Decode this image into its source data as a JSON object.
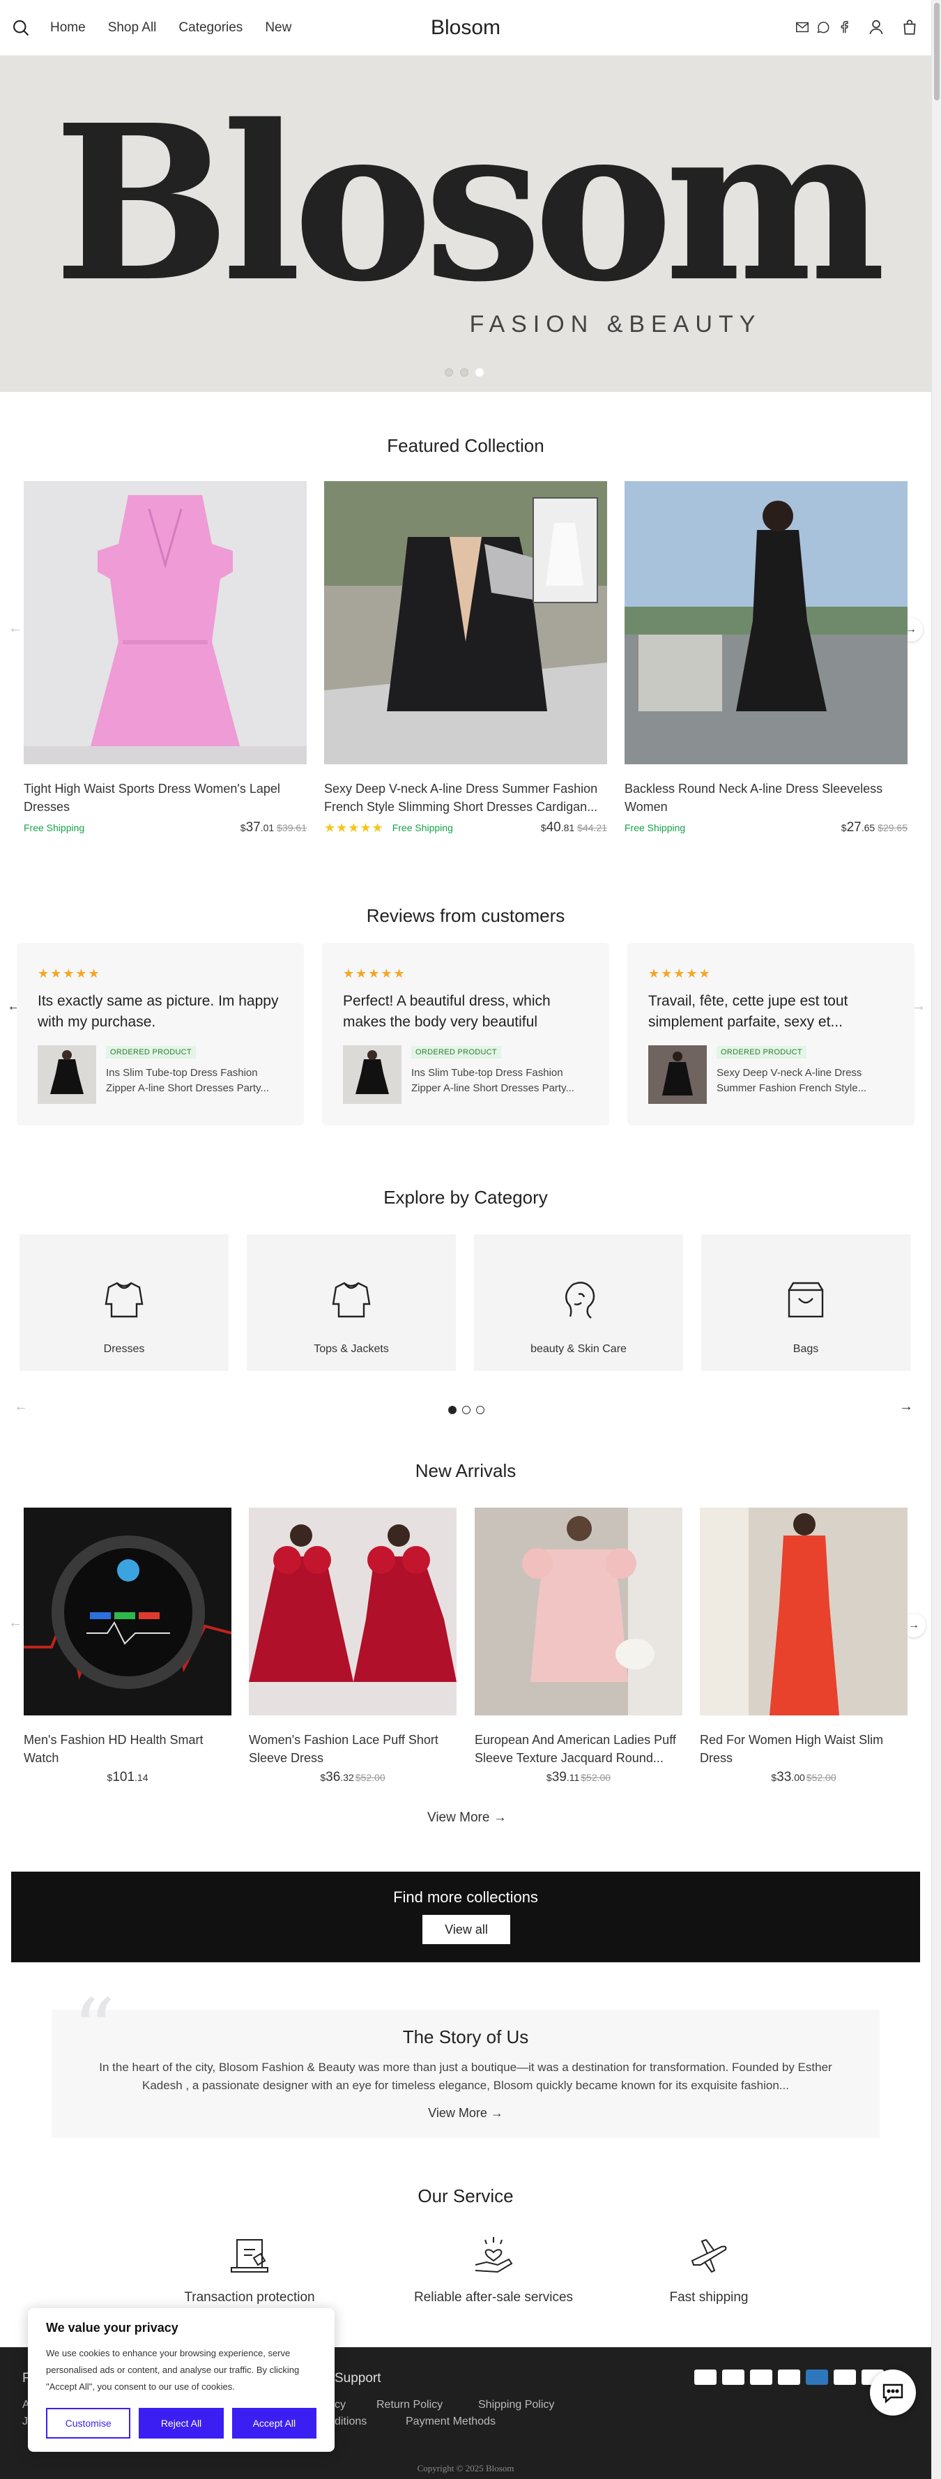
{
  "header": {
    "nav": [
      "Home",
      "Shop All",
      "Categories",
      "New"
    ],
    "brand": "Blosom"
  },
  "hero": {
    "logo_text": "Blosom",
    "subtitle": "FASION &BEAUTY",
    "slides": 3,
    "active_slide": 3
  },
  "featured": {
    "title": "Featured Collection",
    "products": [
      {
        "name": "Tight High Waist Sports Dress Women's Lapel Dresses",
        "stars": "",
        "shipping": "Free Shipping",
        "currency": "$",
        "price_int": "37",
        "price_dec": ".01",
        "old_price": "$39.61"
      },
      {
        "name": "Sexy Deep V-neck A-line Dress Summer Fashion French Style Slimming Short Dresses Cardigan...",
        "stars": "★★★★★",
        "shipping": "Free Shipping",
        "currency": "$",
        "price_int": "40",
        "price_dec": ".81",
        "old_price": "$44.21"
      },
      {
        "name": "Backless Round Neck A-line Dress Sleeveless Women",
        "stars": "",
        "shipping": "Free Shipping",
        "currency": "$",
        "price_int": "27",
        "price_dec": ".65",
        "old_price": "$29.65"
      }
    ]
  },
  "reviews": {
    "title": "Reviews from customers",
    "items": [
      {
        "stars": "★★★★★",
        "text": "Its exactly same as picture. Im happy with my purchase.",
        "badge": "ORDERED PRODUCT",
        "product": "Ins Slim Tube-top Dress Fashion Zipper A-line Short Dresses Party..."
      },
      {
        "stars": "★★★★★",
        "text": "Perfect! A beautiful dress, which makes the body very beautiful",
        "badge": "ORDERED PRODUCT",
        "product": "Ins Slim Tube-top Dress Fashion Zipper A-line Short Dresses Party..."
      },
      {
        "stars": "★★★★★",
        "text": "Travail, fête, cette jupe est tout simplement parfaite, sexy et...",
        "badge": "ORDERED PRODUCT",
        "product": "Sexy Deep V-neck A-line Dress Summer Fashion French Style..."
      }
    ]
  },
  "categories": {
    "title": "Explore by Category",
    "items": [
      {
        "label": "Dresses",
        "icon": "sweater-icon"
      },
      {
        "label": "Tops & Jackets",
        "icon": "sweater-icon"
      },
      {
        "label": "beauty & Skin Care",
        "icon": "face-icon"
      },
      {
        "label": "Bags",
        "icon": "bag-icon"
      }
    ],
    "pages": 3,
    "active_page": 1
  },
  "new_arrivals": {
    "title": "New Arrivals",
    "products": [
      {
        "name": "Men's Fashion HD Health Smart Watch",
        "currency": "$",
        "price_int": "101",
        "price_dec": ".14",
        "old_price": ""
      },
      {
        "name": "Women's Fashion Lace Puff Short Sleeve Dress",
        "currency": "$",
        "price_int": "36",
        "price_dec": ".32",
        "old_price": "$52.00"
      },
      {
        "name": "European And American Ladies Puff Sleeve Texture Jacquard Round...",
        "currency": "$",
        "price_int": "39",
        "price_dec": ".11",
        "old_price": "$52.00"
      },
      {
        "name": "Red For Women High Waist Slim Dress",
        "currency": "$",
        "price_int": "33",
        "price_dec": ".00",
        "old_price": "$52.00"
      }
    ],
    "view_more": "View More"
  },
  "banner": {
    "title": "Find more collections",
    "button": "View all"
  },
  "story": {
    "title": "The Story of Us",
    "text": "In the heart of the city, Blosom Fashion & Beauty was more than just a boutique—it was a destination for transformation. Founded by Esther Kadesh , a passionate designer with an eye for timeless elegance, Blosom quickly became known for its exquisite fashion...",
    "view_more": "View More"
  },
  "service": {
    "title": "Our Service",
    "items": [
      {
        "label": "Transaction protection",
        "icon": "secure-payment-icon"
      },
      {
        "label": "Reliable after-sale services",
        "icon": "heart-hand-icon"
      },
      {
        "label": "Fast shipping",
        "icon": "airplane-icon"
      }
    ]
  },
  "footer": {
    "support_heading": "Support",
    "links": [
      "Return Policy",
      "Shipping Policy",
      "Payment Methods"
    ],
    "partial_heading": "F",
    "partial_link_1": "A",
    "partial_link_2": "J",
    "partial_link_3": "cy",
    "partial_link_4": "ditions",
    "copyright": "Copyright © 2025 Blosom"
  },
  "cookie": {
    "title": "We value your privacy",
    "text": "We use cookies to enhance your browsing experience, serve personalised ads or content, and analyse our traffic. By clicking \"Accept All\", you consent to our use of cookies.",
    "customise": "Customise",
    "reject": "Reject All",
    "accept": "Accept All"
  },
  "colors": {
    "accent": "#3b1ff2",
    "free_shipping": "#16a34a",
    "star": "#f5c518",
    "footer_bg": "#1f1f1f"
  }
}
